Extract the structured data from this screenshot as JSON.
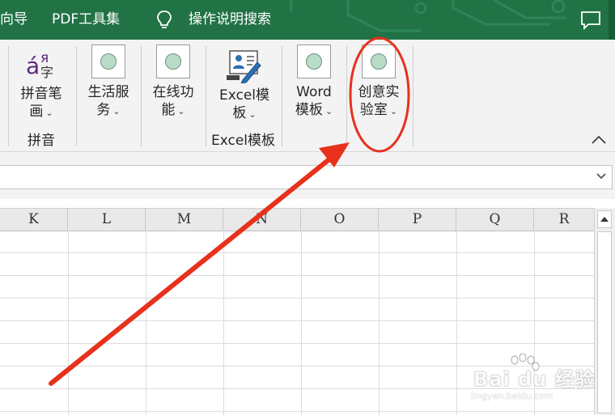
{
  "titlebar": {
    "left_fragment": "向导",
    "pdf_tools": "PDF工具集",
    "search_label": "操作说明搜索"
  },
  "ribbon": {
    "pinyin_button": {
      "line1": "拼音笔",
      "line2": "画"
    },
    "pinyin_group": "拼音",
    "life_service": {
      "line1": "生活服",
      "line2": "务"
    },
    "online_func": {
      "line1": "在线功",
      "line2": "能"
    },
    "excel_template": {
      "line1": "Excel模",
      "line2": "板"
    },
    "excel_group": "Excel模板",
    "word_template": {
      "line1": "Word",
      "line2": "模板"
    },
    "creative_lab": {
      "line1": "创意实",
      "line2": "验室"
    },
    "chevron": "⌄"
  },
  "columns": [
    "K",
    "L",
    "M",
    "N",
    "O",
    "P",
    "Q",
    "R"
  ],
  "colors": {
    "title_green": "#217346",
    "annotation_red": "#e8311c"
  },
  "watermark": {
    "brand": "Bai du 经验",
    "site": "jingyan.baidu.com"
  }
}
